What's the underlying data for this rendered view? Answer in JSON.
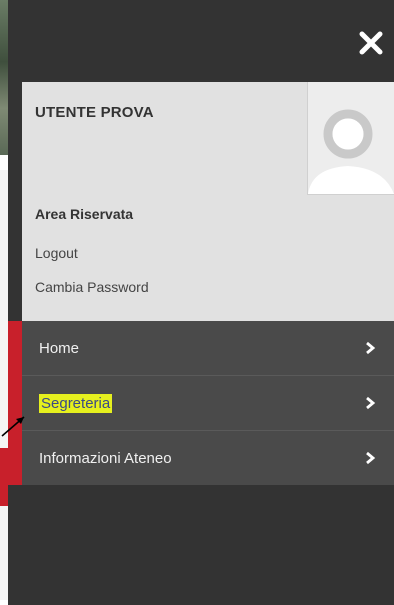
{
  "user_panel": {
    "name": "UTENTE PROVA",
    "area_title": "Area Riservata",
    "links": [
      "Logout",
      "Cambia Password"
    ]
  },
  "nav": {
    "items": [
      {
        "label": "Home",
        "highlighted": false
      },
      {
        "label": "Segreteria",
        "highlighted": true
      },
      {
        "label": "Informazioni Ateneo",
        "highlighted": false
      }
    ]
  },
  "icons": {
    "close": "close-icon",
    "avatar": "user-avatar-icon",
    "chevron": "chevron-right-icon",
    "annotation": "arrow-annotation"
  },
  "colors": {
    "menu_bg": "#333333",
    "nav_bg": "#4a4a4a",
    "accent": "#c8202b",
    "highlight": "#e6f01e",
    "panel_bg": "#e1e1e1"
  }
}
